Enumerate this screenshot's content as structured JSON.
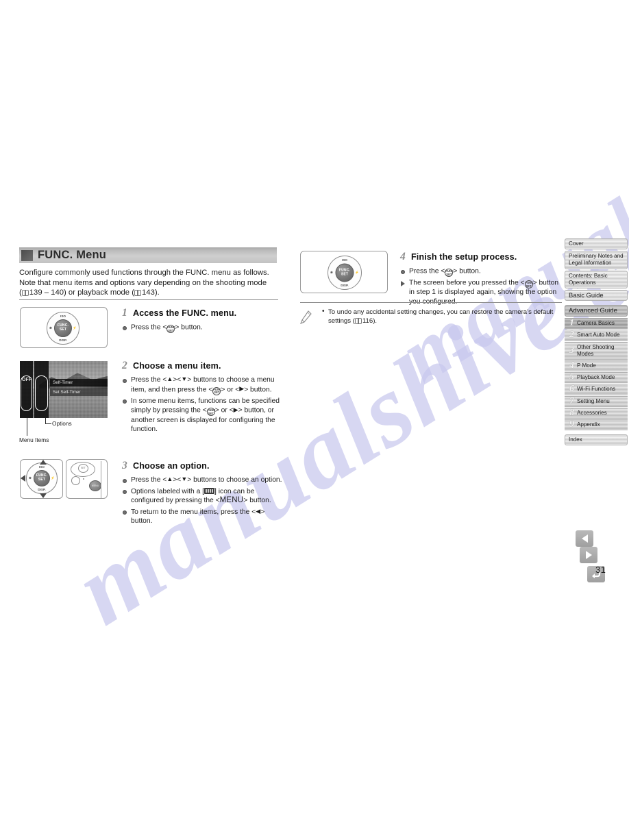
{
  "watermark": {
    "line1": "manualshive.com",
    "line2": "manualshive.com"
  },
  "section": {
    "title": "FUNC. Menu",
    "intro_line1": "Configure commonly used functions through the FUNC. menu as follows.",
    "intro_line2": "Note that menu items and options vary depending on the shooting mode",
    "intro_ref1": "139 – 140) or playback mode (",
    "intro_ref2": "143)."
  },
  "steps": [
    {
      "number": "1",
      "title": "Access the FUNC. menu.",
      "bullets": [
        {
          "kind": "dot",
          "pre": "Press the <",
          "glyph": "set",
          "post": "> button."
        }
      ]
    },
    {
      "number": "2",
      "title": "Choose a menu item.",
      "bullets": [
        {
          "kind": "dot",
          "text": "Press the <▲><▼> buttons to choose a menu item, and then press the <SET> or <▶> button."
        },
        {
          "kind": "dot",
          "text": "In some menu items, functions can be specified simply by pressing the <SET> or <▶> button, or another screen is displayed for configuring the function."
        }
      ]
    },
    {
      "number": "3",
      "title": "Choose an option.",
      "bullets": [
        {
          "kind": "dot",
          "text": "Press the <▲><▼> buttons to choose an option."
        },
        {
          "kind": "dot",
          "text": "Options labeled with a [MENU] icon can be configured by pressing the <MENU> button."
        },
        {
          "kind": "dot",
          "text": "To return to the menu items, press the <◀> button."
        }
      ]
    },
    {
      "number": "4",
      "title": "Finish the setup process.",
      "bullets": [
        {
          "kind": "dot",
          "text": "Press the <SET> button."
        },
        {
          "kind": "tri",
          "text": "The screen before you pressed the <SET> button in step 1 is displayed again, showing the option you configured."
        }
      ]
    }
  ],
  "note": {
    "text_line1": "To undo any accidental setting changes, you can restore the camera’s default",
    "text_line2": "settings (",
    "text_ref": "116)."
  },
  "lcd": {
    "option_selected": "Self-Timer",
    "option_second": "Set Self-Timer",
    "menu_glyph": "OFF",
    "label_options": "Options",
    "label_menu_items": "Menu Items"
  },
  "dial": {
    "center_line1": "FUNC.",
    "center_line2": "SET",
    "top": "ISO",
    "bottom": "DISP.",
    "left": "❀",
    "right": "⚡"
  },
  "sidenav": {
    "items": [
      {
        "label": "Cover",
        "type": "plain"
      },
      {
        "label": "Preliminary Notes and Legal Information",
        "type": "plain"
      },
      {
        "label": "Contents: Basic Operations",
        "type": "plain"
      },
      {
        "label": "Basic Guide",
        "type": "big"
      },
      {
        "label": "Advanced Guide",
        "type": "group"
      },
      {
        "num": "1",
        "label": "Camera Basics",
        "type": "numbered",
        "active": true
      },
      {
        "num": "2",
        "label": "Smart Auto Mode",
        "type": "numbered",
        "active": false
      },
      {
        "num": "3",
        "label": "Other Shooting Modes",
        "type": "numbered",
        "active": false
      },
      {
        "num": "4",
        "label": "P Mode",
        "type": "numbered",
        "active": false
      },
      {
        "num": "5",
        "label": "Playback Mode",
        "type": "numbered",
        "active": false
      },
      {
        "num": "6",
        "label": "Wi-Fi Functions",
        "type": "numbered",
        "active": false
      },
      {
        "num": "7",
        "label": "Setting Menu",
        "type": "numbered",
        "active": false
      },
      {
        "num": "8",
        "label": "Accessories",
        "type": "numbered",
        "active": false
      },
      {
        "num": "9",
        "label": "Appendix",
        "type": "numbered",
        "active": false
      },
      {
        "label": "Index",
        "type": "plain"
      }
    ]
  },
  "pagenav": {
    "prev_label": "◀",
    "next_label": "▶",
    "home_label": "↰",
    "page_number": "31"
  },
  "colors": {
    "header_bar": "#c2c2c2",
    "nav_button": "#a9a9a9",
    "watermark": "#c9c9ee",
    "active_nav": "#a8a8a8"
  }
}
